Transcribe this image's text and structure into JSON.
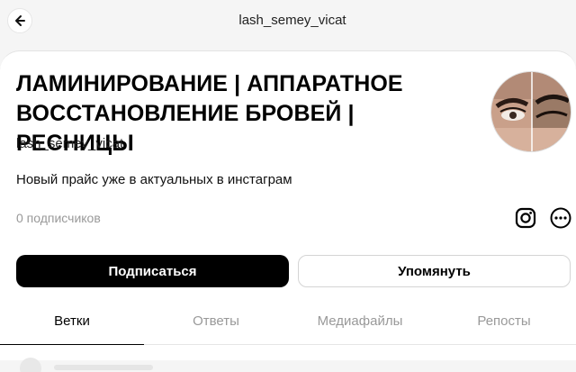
{
  "header": {
    "title": "lash_semey_vicat"
  },
  "profile": {
    "name": "ЛАМИНИРОВАНИЕ | АППАРАТНОЕ ВОССТАНОВЛЕНИЕ БРОВЕЙ | РЕСНИЦЫ",
    "handle": "lash_semey_vicat",
    "bio": "Новый прайс уже в актуальных в инстаграм",
    "followers": "0 подписчиков"
  },
  "actions": {
    "follow_label": "Подписаться",
    "mention_label": "Упомянуть"
  },
  "tabs": [
    {
      "label": "Ветки",
      "active": true
    },
    {
      "label": "Ответы",
      "active": false
    },
    {
      "label": "Медиафайлы",
      "active": false
    },
    {
      "label": "Репосты",
      "active": false
    }
  ],
  "icons": {
    "back": "arrow-left-icon",
    "instagram": "instagram-icon",
    "more": "more-icon"
  },
  "colors": {
    "primary_button": "#000000",
    "muted_text": "#999999"
  }
}
